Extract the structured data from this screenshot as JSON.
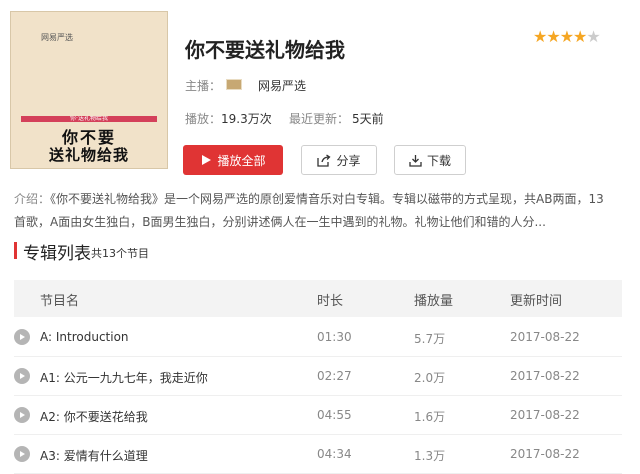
{
  "album": {
    "title": "你不要送礼物给我",
    "rating_stars": 4,
    "rating_max": 5,
    "cover": {
      "top_text": "网易严选",
      "band_text": "你·送礼物给我",
      "line1": "你不要",
      "line2": "送礼物给我"
    }
  },
  "meta": {
    "anchor_label": "主播：",
    "anchor_name": "网易严选",
    "plays_label": "播放：",
    "plays_value": "19.3万次",
    "updated_label": "最近更新：",
    "updated_value": "5天前"
  },
  "actions": {
    "play_all": "播放全部",
    "share": "分享",
    "download": "下载"
  },
  "intro": {
    "label": "介绍：",
    "text": "《你不要送礼物给我》是一个网易严选的原创爱情音乐对白专辑。专辑以磁带的方式呈现，共AB两面，13首歌，A面由女生独白，B面男生独白，分别讲述俩人在一生中遇到的礼物。礼物让他们和错的人分..."
  },
  "list": {
    "title": "专辑列表",
    "count": "共13个节目",
    "columns": [
      "节目名",
      "时长",
      "播放量",
      "更新时间"
    ],
    "rows": [
      {
        "name": "A: Introduction",
        "duration": "01:30",
        "plays": "5.7万",
        "date": "2017-08-22"
      },
      {
        "name": "A1: 公元一九九七年，我走近你",
        "duration": "02:27",
        "plays": "2.0万",
        "date": "2017-08-22"
      },
      {
        "name": "A2: 你不要送花给我",
        "duration": "04:55",
        "plays": "1.6万",
        "date": "2017-08-22"
      },
      {
        "name": "A3: 爱情有什么道理",
        "duration": "04:34",
        "plays": "1.3万",
        "date": "2017-08-22"
      }
    ]
  },
  "colors": {
    "accent": "#e03434",
    "star": "#f5a623"
  }
}
